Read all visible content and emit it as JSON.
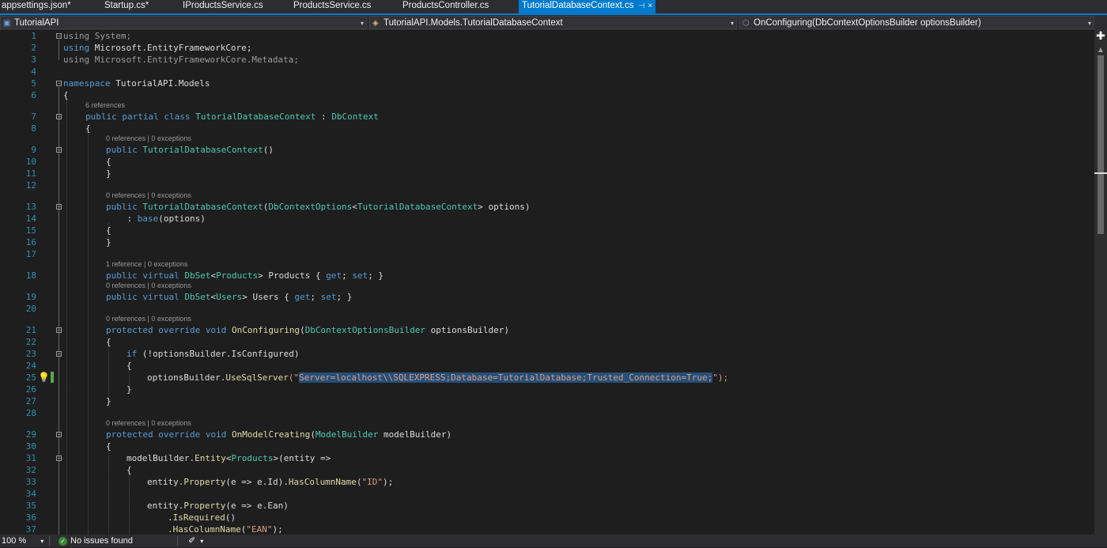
{
  "tabs": [
    {
      "label": "appsettings.json*"
    },
    {
      "label": "Startup.cs*"
    },
    {
      "label": "IProductsService.cs"
    },
    {
      "label": "ProductsService.cs"
    },
    {
      "label": "ProductsController.cs"
    },
    {
      "label": "TutorialDatabaseContext.cs",
      "active": true,
      "pin": "⊣",
      "close": "×"
    }
  ],
  "navbar": {
    "project": "TutorialAPI",
    "class_path": "TutorialAPI.Models.TutorialDatabaseContext",
    "member": "OnConfiguring(DbContextOptionsBuilder optionsBuilder)",
    "dropdown_glyph": "▾"
  },
  "editor": {
    "line_numbers": [
      "1",
      "2",
      "3",
      "4",
      "5",
      "6",
      "7",
      "8",
      "9",
      "10",
      "11",
      "12",
      "13",
      "14",
      "15",
      "16",
      "17",
      "18",
      "19",
      "20",
      "21",
      "22",
      "23",
      "24",
      "25",
      "26",
      "27",
      "28",
      "29",
      "30",
      "31",
      "32",
      "33",
      "34",
      "35",
      "36",
      "37"
    ],
    "codelens": {
      "refs6": "6 references",
      "refs0": "0 references | 0 exceptions",
      "refs1": "1 reference | 0 exceptions"
    },
    "lines": {
      "l1a": "using",
      "l1b": " System;",
      "l2a": "using",
      "l2b": " Microsoft.EntityFrameworkCore;",
      "l3a": "using",
      "l3b": " Microsoft.EntityFrameworkCore.Metadata;",
      "l5a": "namespace",
      "l5b": " TutorialAPI.Models",
      "ob": "{",
      "cb": "}",
      "l7a": "public",
      "l7b": " partial",
      "l7c": " class",
      "l7d": " TutorialDatabaseContext",
      "l7e": " : ",
      "l7f": "DbContext",
      "l9a": "public",
      "l9b": " TutorialDatabaseContext",
      "l9c": "()",
      "l13a": "public",
      "l13b": " TutorialDatabaseContext",
      "l13c": "(",
      "l13d": "DbContextOptions",
      "l13e": "<",
      "l13f": "TutorialDatabaseContext",
      "l13g": "> options)",
      "l14a": "    : ",
      "l14b": "base",
      "l14c": "(options)",
      "l18a": "public",
      "l18b": " virtual",
      "l18c": " DbSet",
      "l18d": "<",
      "l18e": "Products",
      "l18f": "> Products { ",
      "l18g": "get",
      "l18h": "; ",
      "l18i": "set",
      "l18j": "; }",
      "l19a": "public",
      "l19b": " virtual",
      "l19c": " DbSet",
      "l19d": "<",
      "l19e": "Users",
      "l19f": "> Users { ",
      "l19g": "get",
      "l19h": "; ",
      "l19i": "set",
      "l19j": "; }",
      "l21a": "protected",
      "l21b": " override",
      "l21c": " void",
      "l21d": " OnConfiguring",
      "l21e": "(",
      "l21f": "DbContextOptionsBuilder",
      "l21g": " optionsBuilder)",
      "l23a": "if",
      "l23b": " (!optionsBuilder.IsConfigured)",
      "l25a": "optionsBuilder.",
      "l25b": "UseSqlServer",
      "l25c": "(\"",
      "l25d": "Server=localhost\\\\SQLEXPRESS;Database=TutorialDatabase;Trusted_Connection=True;",
      "l25e": "\");",
      "l29a": "protected",
      "l29b": " override",
      "l29c": " void",
      "l29d": " OnModelCreating",
      "l29e": "(",
      "l29f": "ModelBuilder",
      "l29g": " modelBuilder)",
      "l31a": "modelBuilder.",
      "l31b": "Entity",
      "l31c": "<",
      "l31d": "Products",
      "l31e": ">(entity =>",
      "l33a": "entity.",
      "l33b": "Property",
      "l33c": "(e => e.Id).",
      "l33d": "HasColumnName",
      "l33e": "(",
      "l33f": "\"ID\"",
      "l33g": ");",
      "l35a": "entity.",
      "l35b": "Property",
      "l35c": "(e => e.Ean)",
      "l36a": ".",
      "l36b": "IsRequired",
      "l36c": "()",
      "l37a": ".",
      "l37b": "HasColumnName",
      "l37c": "(",
      "l37d": "\"EAN\"",
      "l37e": ");"
    },
    "fold_glyph": "−"
  },
  "statusbar": {
    "zoom": "100 %",
    "zoom_dd": "▾",
    "issues": "No issues found",
    "check": "✓",
    "brush": "✐",
    "brush_dd": "▾"
  },
  "scroll": {
    "up": "▲",
    "split": "✚"
  },
  "colors": {
    "accent": "#007acc",
    "keyword": "#569cd6",
    "type": "#4ec9b0",
    "string": "#d69d85",
    "method": "#dcdcaa",
    "line_number": "#2b91af"
  }
}
